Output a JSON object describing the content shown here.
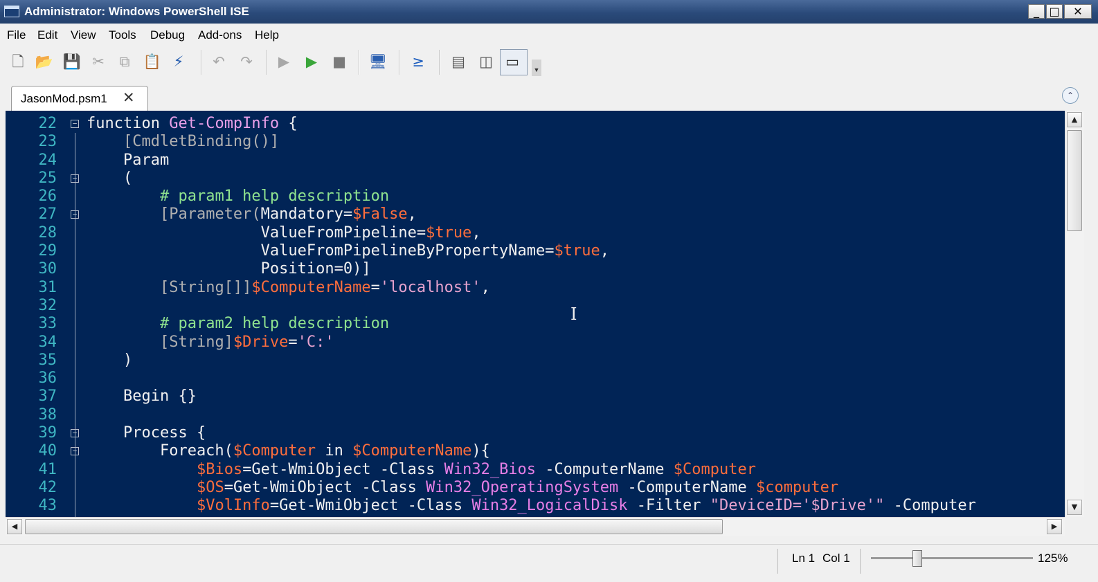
{
  "window": {
    "title": "Administrator: Windows PowerShell ISE",
    "minimize_glyph": "_",
    "maximize_glyph": "□",
    "close_glyph": "✕"
  },
  "menu": [
    "File",
    "Edit",
    "View",
    "Tools",
    "Debug",
    "Add-ons",
    "Help"
  ],
  "toolbar": [
    {
      "name": "new-icon",
      "glyph": "🗋",
      "color": "#555555"
    },
    {
      "name": "open-icon",
      "glyph": "📂",
      "color": "#d8a62a"
    },
    {
      "name": "save-icon",
      "glyph": "💾",
      "color": "#2a5fb0"
    },
    {
      "name": "cut-icon",
      "glyph": "✂",
      "color": "#a0a0a0"
    },
    {
      "name": "copy-icon",
      "glyph": "⧉",
      "color": "#a0a0a0"
    },
    {
      "name": "paste-icon",
      "glyph": "📋",
      "color": "#555555"
    },
    {
      "name": "clear-console-icon",
      "glyph": "⚡",
      "color": "#2a60b0"
    },
    {
      "name": "undo-icon",
      "glyph": "↶",
      "color": "#a8a8a8"
    },
    {
      "name": "redo-icon",
      "glyph": "↷",
      "color": "#a8a8a8"
    },
    {
      "name": "run-script-icon",
      "glyph": "▶",
      "color": "#a8a8a8"
    },
    {
      "name": "run-selection-icon",
      "glyph": "▶",
      "color": "#3aa63a"
    },
    {
      "name": "stop-icon",
      "glyph": "■",
      "color": "#7a7a7a"
    },
    {
      "name": "remote-powershell-icon",
      "glyph": "🖥",
      "color": "#2a5fb0"
    },
    {
      "name": "powershell-console-icon",
      "glyph": "≥",
      "color": "#1f5fbf"
    },
    {
      "name": "layout-top-icon",
      "glyph": "▤",
      "color": "#555555"
    },
    {
      "name": "layout-right-icon",
      "glyph": "◫",
      "color": "#555555"
    },
    {
      "name": "layout-maximized-icon",
      "glyph": "▭",
      "color": "#333333"
    }
  ],
  "tab": {
    "label": "JasonMod.psm1",
    "close_glyph": "✕"
  },
  "collapse_glyph": "⌃",
  "code_lines": [
    {
      "n": "22",
      "fold": true,
      "tokens": [
        [
          "kw",
          "function "
        ],
        [
          "fn",
          "Get-CompInfo"
        ],
        [
          "kw",
          " {"
        ]
      ]
    },
    {
      "n": "23",
      "tokens": [
        [
          "tx",
          "    "
        ],
        [
          "ty",
          "[CmdletBinding()]"
        ]
      ]
    },
    {
      "n": "24",
      "tokens": [
        [
          "kw",
          "    Param"
        ]
      ]
    },
    {
      "n": "25",
      "fold": true,
      "tokens": [
        [
          "tx",
          "    ("
        ]
      ]
    },
    {
      "n": "26",
      "tokens": [
        [
          "tx",
          "        "
        ],
        [
          "cm",
          "# param1 help description"
        ]
      ]
    },
    {
      "n": "27",
      "fold": true,
      "tokens": [
        [
          "tx",
          "        "
        ],
        [
          "ty",
          "[Parameter("
        ],
        [
          "tx",
          "Mandatory="
        ],
        [
          "vr",
          "$False"
        ],
        [
          "tx",
          ","
        ]
      ]
    },
    {
      "n": "28",
      "tokens": [
        [
          "tx",
          "                   ValueFromPipeline="
        ],
        [
          "vr",
          "$true"
        ],
        [
          "tx",
          ","
        ]
      ]
    },
    {
      "n": "29",
      "tokens": [
        [
          "tx",
          "                   ValueFromPipelineByPropertyName="
        ],
        [
          "vr",
          "$true"
        ],
        [
          "tx",
          ","
        ]
      ]
    },
    {
      "n": "30",
      "tokens": [
        [
          "tx",
          "                   Position=0)]"
        ]
      ]
    },
    {
      "n": "31",
      "tokens": [
        [
          "tx",
          "        "
        ],
        [
          "ty",
          "[String[]]"
        ],
        [
          "vr",
          "$ComputerName"
        ],
        [
          "tx",
          "="
        ],
        [
          "st",
          "'localhost'"
        ],
        [
          "tx",
          ","
        ]
      ]
    },
    {
      "n": "32",
      "tokens": [
        [
          "tx",
          ""
        ]
      ]
    },
    {
      "n": "33",
      "tokens": [
        [
          "tx",
          "        "
        ],
        [
          "cm",
          "# param2 help description"
        ]
      ]
    },
    {
      "n": "34",
      "tokens": [
        [
          "tx",
          "        "
        ],
        [
          "ty",
          "[String]"
        ],
        [
          "vr",
          "$Drive"
        ],
        [
          "tx",
          "="
        ],
        [
          "st",
          "'C:'"
        ]
      ]
    },
    {
      "n": "35",
      "tokens": [
        [
          "tx",
          "    )"
        ]
      ]
    },
    {
      "n": "36",
      "tokens": [
        [
          "tx",
          ""
        ]
      ]
    },
    {
      "n": "37",
      "tokens": [
        [
          "kw",
          "    Begin {}"
        ]
      ]
    },
    {
      "n": "38",
      "tokens": [
        [
          "tx",
          ""
        ]
      ]
    },
    {
      "n": "39",
      "fold": true,
      "tokens": [
        [
          "kw",
          "    Process {"
        ]
      ]
    },
    {
      "n": "40",
      "fold": true,
      "tokens": [
        [
          "kw",
          "        Foreach("
        ],
        [
          "vr",
          "$Computer"
        ],
        [
          "kw",
          " in "
        ],
        [
          "vr",
          "$ComputerName"
        ],
        [
          "kw",
          "){"
        ]
      ]
    },
    {
      "n": "41",
      "tokens": [
        [
          "tx",
          "            "
        ],
        [
          "vr",
          "$Bios"
        ],
        [
          "tx",
          "=Get-WmiObject -Class "
        ],
        [
          "mb",
          "Win32_Bios"
        ],
        [
          "tx",
          " -ComputerName "
        ],
        [
          "vr",
          "$Computer"
        ]
      ]
    },
    {
      "n": "42",
      "tokens": [
        [
          "tx",
          "            "
        ],
        [
          "vr",
          "$OS"
        ],
        [
          "tx",
          "=Get-WmiObject -Class "
        ],
        [
          "mb",
          "Win32_OperatingSystem"
        ],
        [
          "tx",
          " -ComputerName "
        ],
        [
          "vr",
          "$computer"
        ]
      ]
    },
    {
      "n": "43",
      "tokens": [
        [
          "tx",
          "            "
        ],
        [
          "vr",
          "$VolInfo"
        ],
        [
          "tx",
          "=Get-WmiObject -Class "
        ],
        [
          "mb",
          "Win32_LogicalDisk"
        ],
        [
          "tx",
          " -Filter "
        ],
        [
          "st",
          "\"DeviceID='$Drive'\""
        ],
        [
          "tx",
          " -Computer"
        ]
      ]
    }
  ],
  "scroll_glyphs": {
    "up": "▲",
    "down": "▼",
    "left": "◀",
    "right": "▶"
  },
  "status": {
    "line": "Ln 1",
    "col": "Col 1",
    "zoom": "125%"
  },
  "zoom_level_percent": 125
}
